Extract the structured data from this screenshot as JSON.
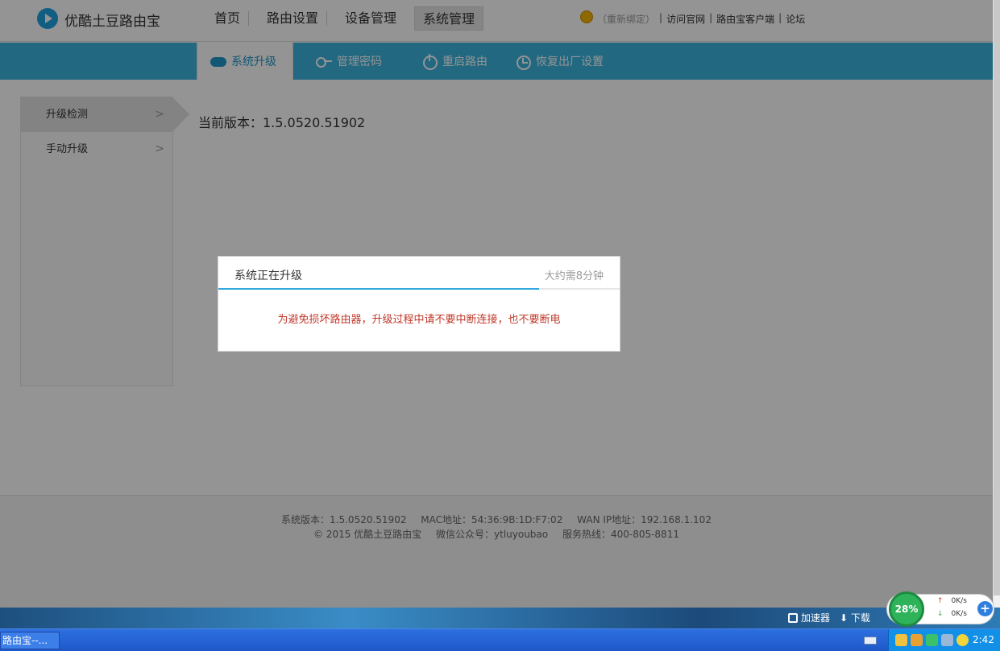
{
  "header": {
    "brand": "优酷土豆路由宝",
    "nav": [
      "首页",
      "路由设置",
      "设备管理",
      "系统管理"
    ],
    "active_nav": "系统管理",
    "links": {
      "rebind": "（重新绑定）",
      "official_site": "访问官网",
      "client": "路由宝客户端",
      "forum": "论坛",
      "separator": "|"
    }
  },
  "subnav": {
    "tabs": [
      "系统升级",
      "管理密码",
      "重启路由",
      "恢复出厂设置"
    ],
    "active": "系统升级"
  },
  "sidebar": {
    "items": [
      {
        "label": "升级检测",
        "chevron": ">"
      },
      {
        "label": "手动升级",
        "chevron": ">"
      }
    ]
  },
  "main": {
    "current_version": "当前版本：1.5.0520.51902"
  },
  "modal": {
    "title": "系统正在升级",
    "estimate": "大约需8分钟",
    "warning": "为避免损坏路由器，升级过程中请不要中断连接，也不要断电",
    "progress": 0.8
  },
  "footer": {
    "system_version": "系统版本：1.5.0520.51902",
    "mac": "MAC地址：54:36:9B:1D:F7:02",
    "wan_ip": "WAN IP地址：192.168.1.102",
    "copyright": "© 2015 优酷土豆路由宝",
    "wechat": "微信公众号：ytluyoubao",
    "hotline": "服务热线：400-805-8811"
  },
  "taskbar": {
    "task_label": "路由宝--...",
    "accelerator": "加速器",
    "download_label": "下载",
    "net_gauge": "28%",
    "upload_speed": "0K/s",
    "download_speed": "0K/s",
    "plus": "+",
    "clock": "2:42"
  },
  "colors": {
    "accent": "#3ab4dd",
    "progress": "#31a8e0",
    "warning": "#c0392b",
    "taskbar": "#1f58c8"
  },
  "icons": [
    "logo-play-icon",
    "coin-icon",
    "cloud-upgrade-icon",
    "key-icon",
    "power-icon",
    "restore-icon",
    "chevron-right-icon",
    "accelerator-icon",
    "download-icon",
    "keyboard-icon",
    "tray-icons"
  ]
}
